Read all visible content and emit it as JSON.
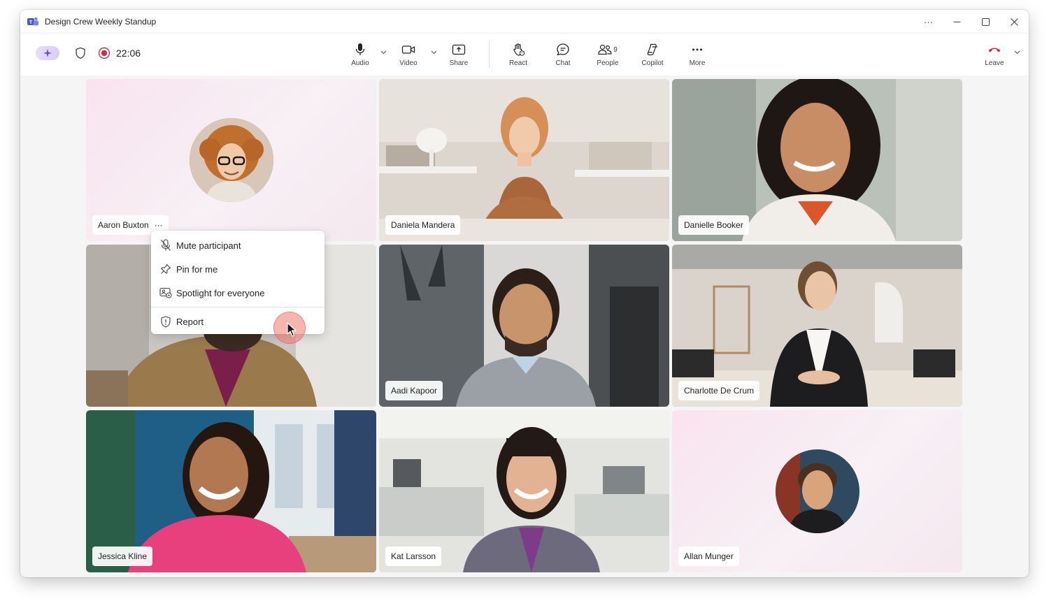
{
  "window": {
    "title": "Design Crew Weekly Standup",
    "controls": {
      "more": "···",
      "minimize": "—",
      "maximize": "☐",
      "close": "✕"
    }
  },
  "toolbar": {
    "timer": "22:06",
    "audio_label": "Audio",
    "video_label": "Video",
    "share_label": "Share",
    "react_label": "React",
    "chat_label": "Chat",
    "people_label": "People",
    "people_count": "9",
    "copilot_label": "Copilot",
    "more_label": "More",
    "leave_label": "Leave"
  },
  "participants": [
    {
      "name": "Aaron Buxton",
      "type": "avatar",
      "more": "···"
    },
    {
      "name": "Daniela Mandera",
      "type": "video"
    },
    {
      "name": "Danielle Booker",
      "type": "video"
    },
    {
      "name": "",
      "type": "video"
    },
    {
      "name": "Aadi Kapoor",
      "type": "video"
    },
    {
      "name": "Charlotte De Crum",
      "type": "video",
      "active_speaker": true
    },
    {
      "name": "Jessica Kline",
      "type": "video"
    },
    {
      "name": "Kat Larsson",
      "type": "video"
    },
    {
      "name": "Allan Munger",
      "type": "avatar"
    }
  ],
  "context_menu": {
    "items": [
      {
        "label": "Mute participant",
        "icon": "mic-off-icon"
      },
      {
        "label": "Pin for me",
        "icon": "pin-icon"
      },
      {
        "label": "Spotlight for everyone",
        "icon": "spotlight-icon"
      },
      {
        "label": "Report",
        "icon": "shield-alert-icon"
      }
    ]
  },
  "colors": {
    "accent": "#5b5fc7",
    "leave_red": "#c4314b",
    "record_red": "#c4314b"
  }
}
